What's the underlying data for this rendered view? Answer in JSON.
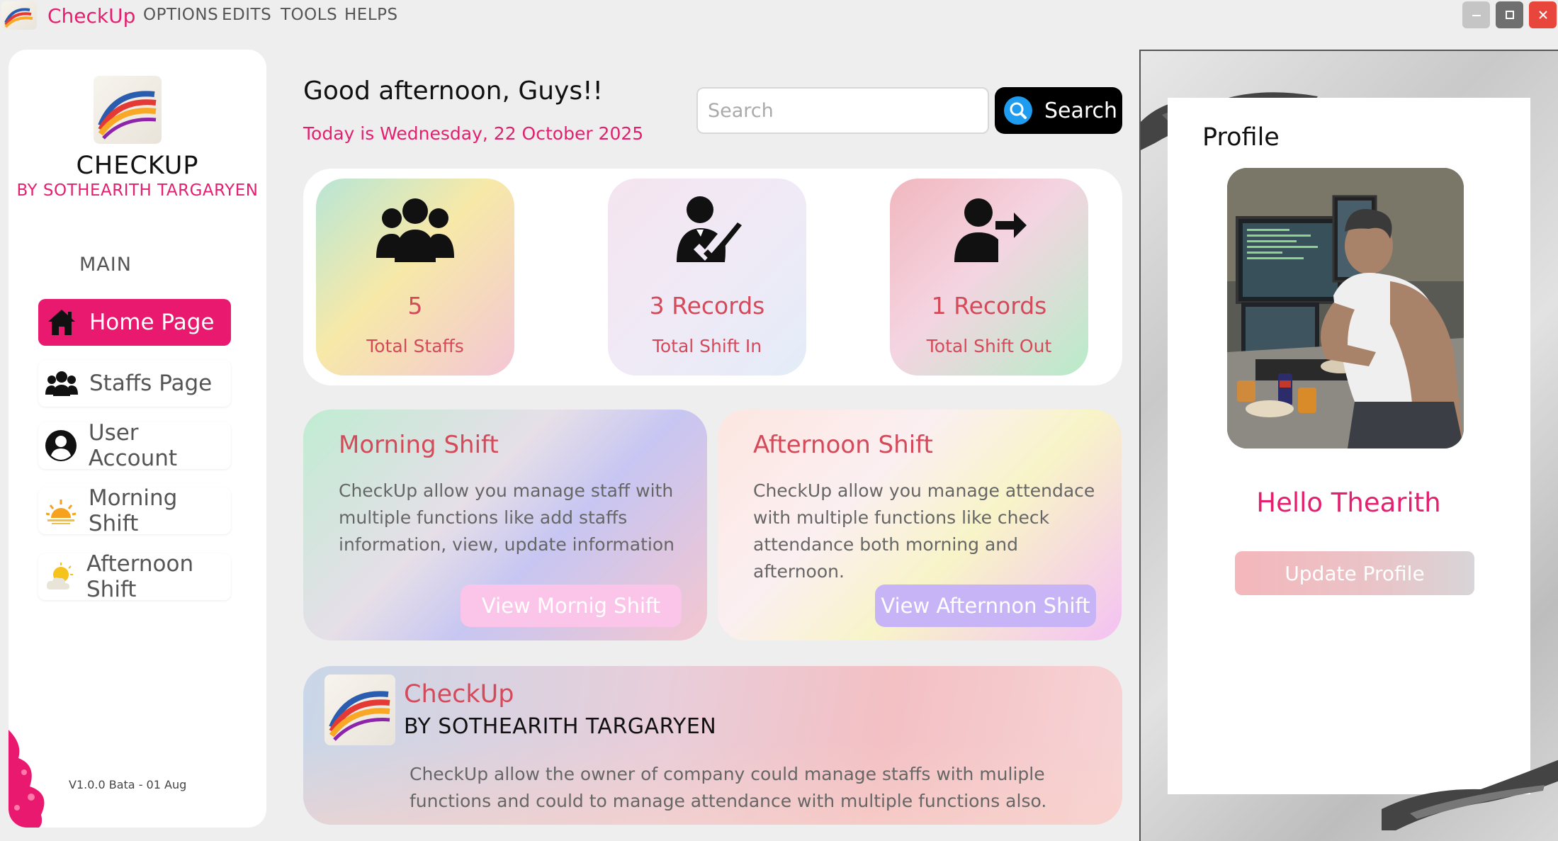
{
  "app": {
    "title": "CheckUp",
    "menu": [
      "OPTIONS",
      "EDITS",
      "TOOLS",
      "HELPS"
    ],
    "window_controls": [
      "minimize",
      "maximize",
      "close"
    ]
  },
  "sidebar": {
    "brand_name": "CHECKUP",
    "brand_author": "BY SOTHEARITH TARGARYEN",
    "section_label": "MAIN",
    "items": [
      {
        "label": "Home Page",
        "icon": "home-icon",
        "active": true
      },
      {
        "label": "Staffs Page",
        "icon": "users-icon",
        "active": false
      },
      {
        "label": "User Account",
        "icon": "user-circle-icon",
        "active": false
      },
      {
        "label": "Morning Shift",
        "icon": "sunrise-icon",
        "active": false
      },
      {
        "label": "Afternoon Shift",
        "icon": "sun-cloud-icon",
        "active": false
      }
    ],
    "version": "V1.0.0 Bata - 01 Aug"
  },
  "header": {
    "greeting": "Good afternoon, Guys!!",
    "today": "Today is Wednesday, 22 October 2025",
    "search_placeholder": "Search",
    "search_value": "",
    "search_button": "Search"
  },
  "stats": [
    {
      "value": "5",
      "label": "Total Staffs",
      "icon": "users-icon"
    },
    {
      "value": "3 Records",
      "label": "Total Shift In",
      "icon": "user-check-icon"
    },
    {
      "value": "1 Records",
      "label": "Total Shift Out",
      "icon": "user-exit-icon"
    }
  ],
  "shifts": {
    "morning": {
      "title": "Morning Shift",
      "description": "CheckUp allow you manage staff with multiple functions like add staffs information, view, update information",
      "button": "View Mornig Shift"
    },
    "afternoon": {
      "title": "Afternoon Shift",
      "description": "CheckUp allow you manage attendace with multiple functions like check attendance both morning and afternoon.",
      "button": "View Afternnon Shift"
    }
  },
  "info": {
    "title": "CheckUp",
    "author": "BY SOTHEARITH TARGARYEN",
    "description": "CheckUp allow the owner of company could manage staffs with muliple functions and could to manage attendance with multiple functions also."
  },
  "profile": {
    "title": "Profile",
    "hello": "Hello  Thearith",
    "update_button": "Update Profile"
  },
  "colors": {
    "accent": "#e8196e",
    "value_text": "#d54a5a",
    "search_button_bg": "#000000"
  }
}
